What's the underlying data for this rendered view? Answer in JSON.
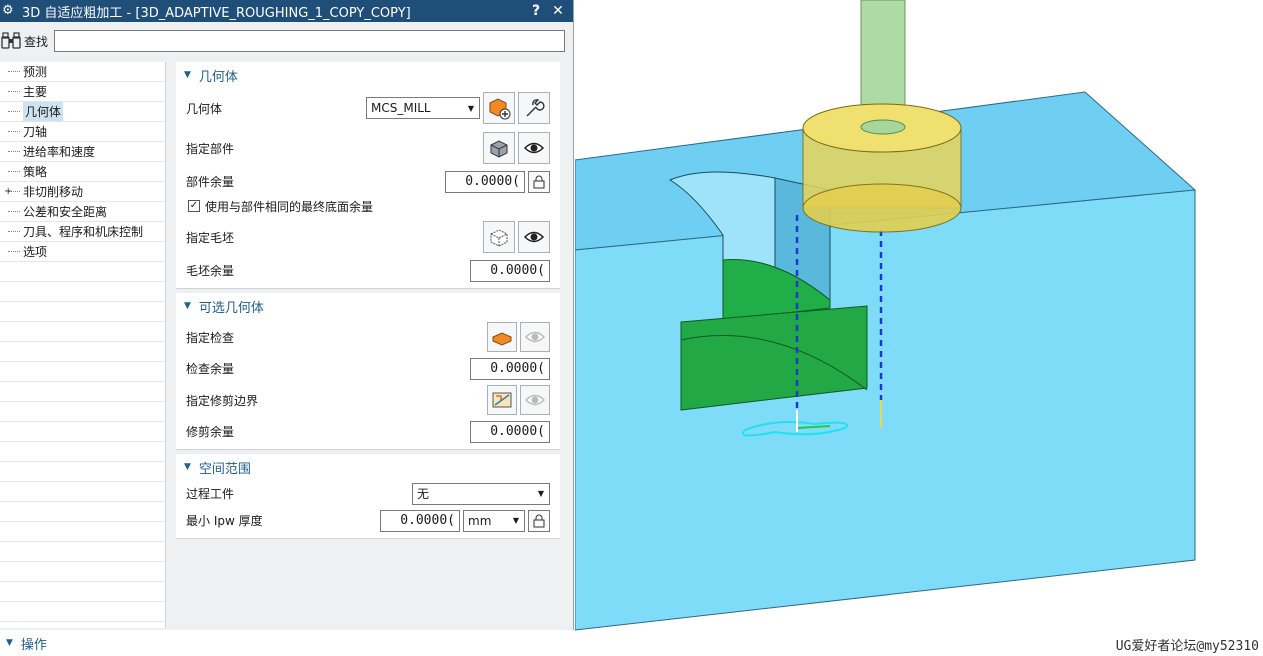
{
  "window": {
    "title": "3D 自适应粗加工 - [3D_ADAPTIVE_ROUGHING_1_COPY_COPY]",
    "help_glyph": "?",
    "close_glyph": "✕"
  },
  "find": {
    "label": "查找",
    "value": ""
  },
  "tree": [
    {
      "label": "预测"
    },
    {
      "label": "主要"
    },
    {
      "label": "几何体",
      "selected": true
    },
    {
      "label": "刀轴"
    },
    {
      "label": "进给率和速度"
    },
    {
      "label": "策略"
    },
    {
      "label": "非切削移动",
      "expandable": true
    },
    {
      "label": "公差和安全距离"
    },
    {
      "label": "刀具、程序和机床控制"
    },
    {
      "label": "选项"
    }
  ],
  "geometry": {
    "title": "几何体",
    "geometry_label": "几何体",
    "geometry_value": "MCS_MILL",
    "part_label": "指定部件",
    "part_stock_label": "部件余量",
    "part_stock_value": "0.0000(",
    "checkbox_label": "使用与部件相同的最终底面余量",
    "checkbox_checked": "✓",
    "blank_label": "指定毛坯",
    "blank_stock_label": "毛坯余量",
    "blank_stock_value": "0.0000("
  },
  "optional": {
    "title": "可选几何体",
    "check_label": "指定检查",
    "check_stock_label": "检查余量",
    "check_stock_value": "0.0000(",
    "trim_label": "指定修剪边界",
    "trim_stock_label": "修剪余量",
    "trim_stock_value": "0.0000("
  },
  "space": {
    "title": "空间范围",
    "ipw_label": "过程工件",
    "ipw_value": "无",
    "min_label": "最小 Ipw 厚度",
    "min_value": "0.0000(",
    "unit": "mm"
  },
  "ops": {
    "title": "操作"
  },
  "watermark": "UG爱好者论坛@my52310",
  "colors": {
    "titlebar": "#1f4e79",
    "accent": "#1f5f8b",
    "block": "#6fd3f5",
    "tool": "#e8d65a",
    "green": "#22a845"
  }
}
